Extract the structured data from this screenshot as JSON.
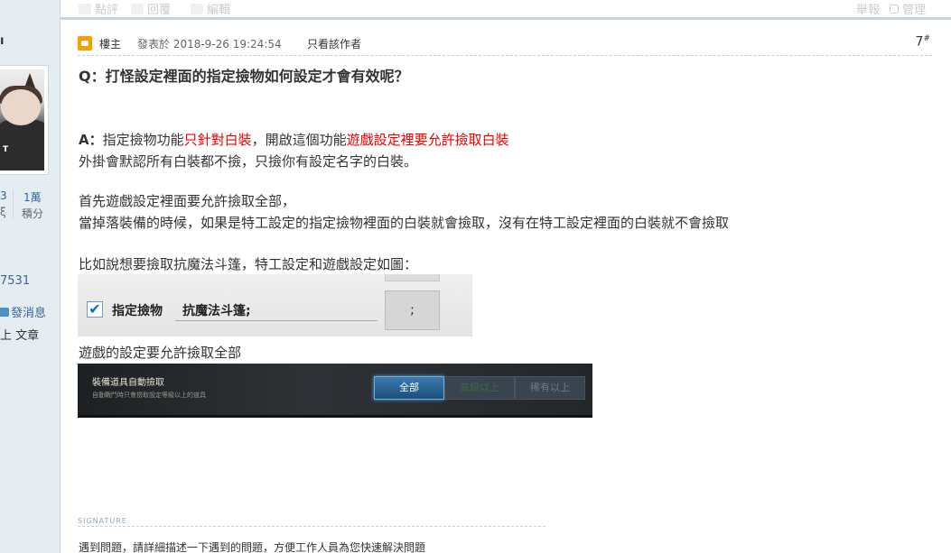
{
  "toolbar": {
    "rate": "點評",
    "reply": "回覆",
    "edit": "編輯",
    "report": "舉報",
    "manage": "管理"
  },
  "profile": {
    "name_fragment": "ı",
    "stat1_value": "3",
    "stat1_label": "ξ",
    "stat2_value": "1萬",
    "stat2_label": "積分",
    "uid_fragment": "7531",
    "message_label": "發消息",
    "posts_label": "上 文章"
  },
  "post": {
    "author_badge": "樓主",
    "posted_at": "發表於 2018-9-26 19:24:54",
    "only_author": "只看該作者",
    "floor": "7",
    "floor_mark": "#"
  },
  "content": {
    "question": "Q：打怪設定裡面的指定撿物如何設定才會有效呢？",
    "answer_prefix": "A：",
    "answer_text1": "指定撿物功能",
    "answer_red1": "只針對白裝",
    "answer_text2": "，開啟這個功能",
    "answer_red2": "遊戲設定裡要允許撿取白裝",
    "line2": "外掛會默認所有白裝都不撿，只撿你有設定名字的白裝。",
    "line3": "首先遊戲設定裡面要允許撿取全部，",
    "line4": "當掉落裝備的時候，如果是特工設定的指定撿物裡面的白裝就會撿取，沒有在特工設定裡面的白裝就不會撿取",
    "line5": "比如說想要撿取抗魔法斗篷，特工設定和遊戲設定如圖：",
    "caption2": "遊戲的設定要允許撿取全部"
  },
  "image1": {
    "checkbox_mark": "✔",
    "label": "指定撿物",
    "field_value": "抗魔法斗篷;",
    "button_label": ";"
  },
  "image2": {
    "title": "裝備道具自動撿取",
    "desc": "自動戰鬥時只會撿取設定等級以上的道具",
    "option_all": "全部",
    "option_advanced": "高級以上",
    "option_rare": "稀有以上"
  },
  "signature": {
    "heading": "SIGNATURE",
    "text": "遇到問題，請詳細描述一下遇到的問題，方便工作人員為您快速解決問題"
  },
  "colors": {
    "red_highlight": "#e00000",
    "link_blue": "#336699",
    "sidebar_bg": "#e5edf2"
  }
}
